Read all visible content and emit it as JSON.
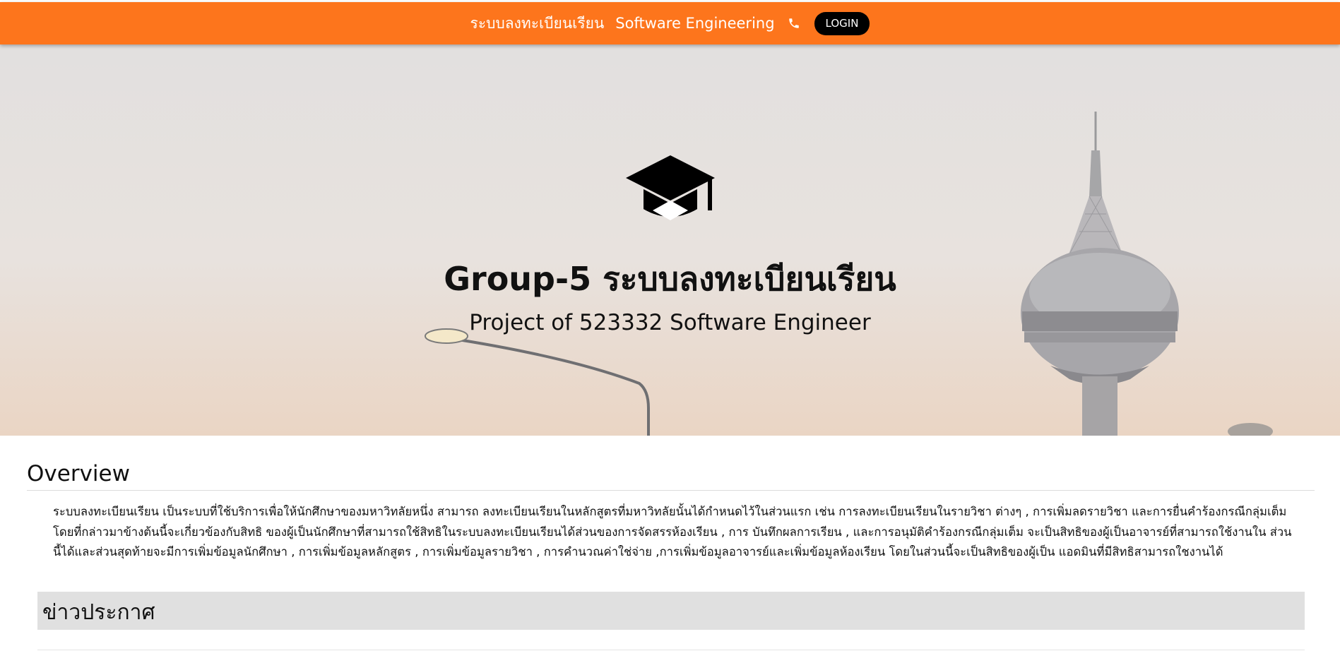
{
  "navbar": {
    "brand": "ระบบลงทะเบียนเรียน",
    "subject": "Software Engineering",
    "phone_icon": "phone-icon",
    "login_label": "LOGIN",
    "background_color": "#fd751c"
  },
  "hero": {
    "icon": "graduation-cap-icon",
    "title": "Group-5 ระบบลงทะเบียนเรียน",
    "subtitle": "Project of 523332 Software Engineer"
  },
  "overview": {
    "heading": "Overview",
    "body": "ระบบลงทะเบียนเรียน เป็นระบบที่ใช้บริการเพื่อให้นักศึกษาของมหาวิทลัยหนึ่ง สามารถ ลงทะเบียนเรียนในหลักสูตรที่มหาวิทลัยนั้นได้กำหนดไว้ในส่วนแรก เช่น การลงทะเบียนเรียนในรายวิชา ต่างๆ , การเพิ่มลดรายวิชา และการยื่นคำร้องกรณีกลุ่มเต็ม โดยที่กล่าวมาข้างต้นนี้จะเกี่ยวข้องกับสิทธิ ของผู้เป็นนักศึกษาที่สามารถใช้สิทธิในระบบลงทะเบียนเรียนได้ส่วนของการจัดสรรห้องเรียน , การ บันทึกผลการเรียน , และการอนุมัติคำร้องกรณีกลุ่มเต็ม จะเป็นสิทธิของผู้เป็นอาจารย์ที่สามารถใช้งานใน ส่วนนี้ได้และส่วนสุดท้ายจะมีการเพิ่มข้อมูลนักศึกษา , การเพิ่มข้อมูลหลักสูตร , การเพิ่มข้อมูลรายวิชา , การคำนวณค่าใช่จ่าย ,การเพิ่มข้อมูลอาจารย์และเพิ่มข้อมูลห้องเรียน โดยในส่วนนี้จะเป็นสิทธิของผู้เป็น แอดมินที่มีสิทธิสามารถใชงานได้"
  },
  "news": {
    "heading": "ข่าวประกาศ"
  }
}
